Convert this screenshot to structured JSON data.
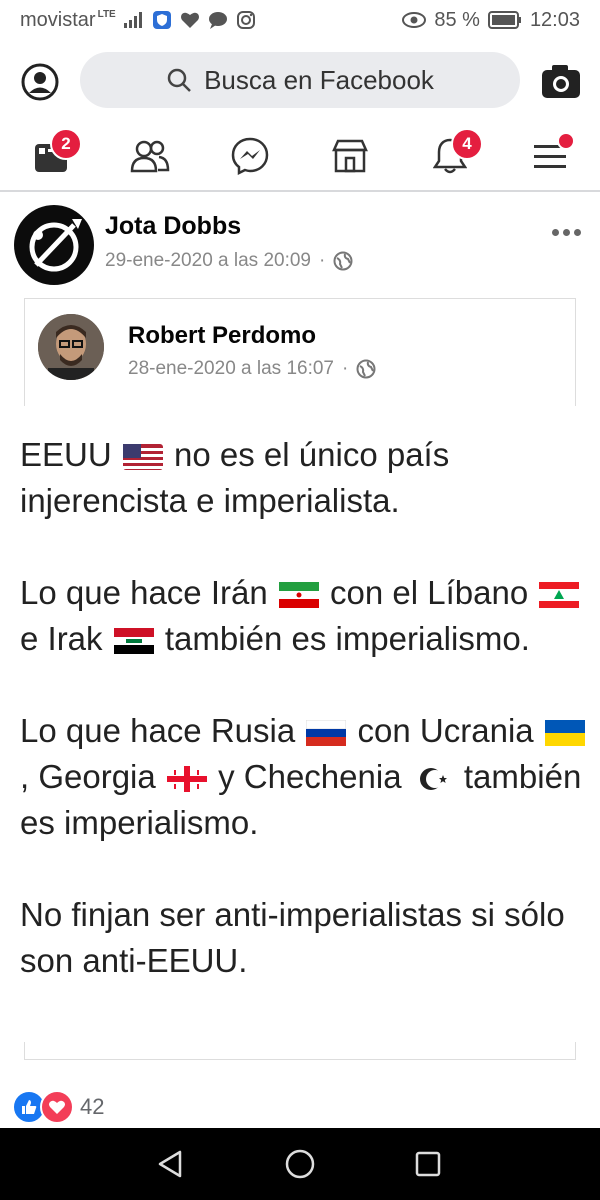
{
  "status_bar": {
    "carrier": "movistar",
    "network": "LTE",
    "battery": "85 %",
    "time": "12:03"
  },
  "top_bar": {
    "search_placeholder": "Busca en Facebook"
  },
  "nav": {
    "feed_badge": "2",
    "notifications_badge": "4"
  },
  "post": {
    "author": "Jota Dobbs",
    "timestamp": "29-ene-2020 a las 20:09",
    "separator": "·",
    "shared": {
      "author": "Robert Perdomo",
      "timestamp": "28-ene-2020 a las 16:07"
    },
    "text": {
      "p1_a": "EEUU",
      "p1_b": "no es el único país injerencista e imperialista.",
      "p2_a": "Lo que hace Irán",
      "p2_b": "con el Líbano",
      "p2_c": "e Irak",
      "p2_d": "también es imperialismo.",
      "p3_a": "Lo que hace Rusia",
      "p3_b": "con Ucrania",
      "p3_c": ", Georgia",
      "p3_d": "y Chechenia",
      "p3_e": "también es imperialismo.",
      "p4": "No finjan ser anti-imperialistas si sólo son anti-EEUU."
    },
    "reaction_count": "42"
  },
  "colors": {
    "badge": "#e41e3f",
    "like": "#1877f2",
    "love": "#f33e58"
  }
}
